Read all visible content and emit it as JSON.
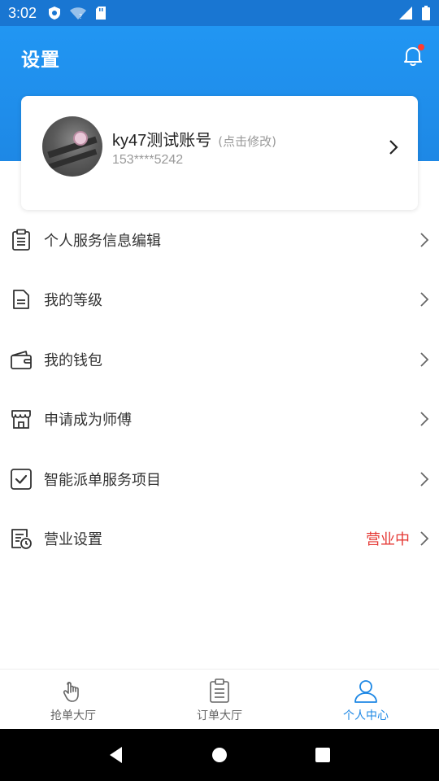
{
  "status_bar": {
    "time": "3:02"
  },
  "header": {
    "title": "设置"
  },
  "profile": {
    "name": "ky47测试账号",
    "edit_hint": "(点击修改)",
    "phone": "153****5242"
  },
  "menu": {
    "items": [
      {
        "label": "个人服务信息编辑",
        "icon": "clipboard-list-icon"
      },
      {
        "label": "我的等级",
        "icon": "document-icon"
      },
      {
        "label": "我的钱包",
        "icon": "wallet-icon"
      },
      {
        "label": "申请成为师傅",
        "icon": "storefront-icon"
      },
      {
        "label": "智能派单服务项目",
        "icon": "checkbox-icon"
      },
      {
        "label": "营业设置",
        "icon": "business-settings-icon",
        "status": "营业中"
      }
    ]
  },
  "bottom_nav": {
    "items": [
      {
        "label": "抢单大厅",
        "icon": "hand-tap-icon",
        "active": false
      },
      {
        "label": "订单大厅",
        "icon": "clipboard-icon",
        "active": false
      },
      {
        "label": "个人中心",
        "icon": "user-icon",
        "active": true
      }
    ]
  },
  "colors": {
    "primary": "#1e88e5",
    "status_active": "#e53935",
    "text": "#333333",
    "muted": "#999999"
  }
}
